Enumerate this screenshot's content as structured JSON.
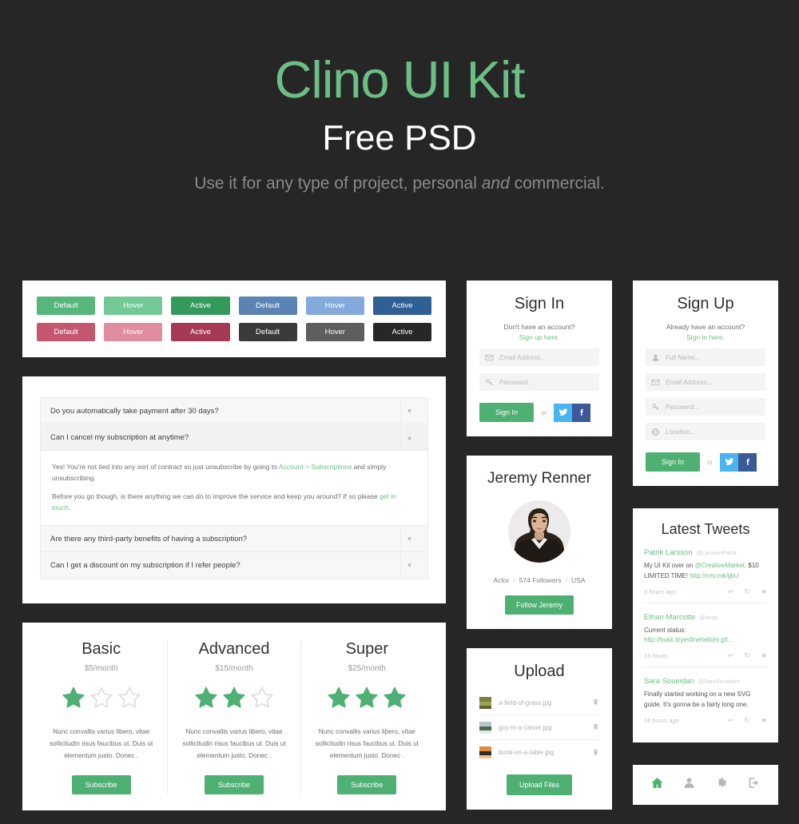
{
  "hero": {
    "title": "Clino UI Kit",
    "subtitle": "Free PSD",
    "description_pre": "Use it for any type of project, personal ",
    "description_em": "and",
    "description_post": " commercial."
  },
  "colors": {
    "background": "#262626",
    "green": "#4fb073",
    "green_light": "#6cbf84",
    "green_hover": "#72c995",
    "green_active": "#349a5c",
    "blue": "#5b83b5",
    "blue_hover": "#84aadb",
    "blue_active": "#2f5f95",
    "pink": "#c5566f",
    "pink_hover": "#e08ba0",
    "pink_active": "#a63a55",
    "dark": "#3b3b3b",
    "dark_hover": "#5e5e5e",
    "dark_active": "#272727",
    "twitter": "#4ab3f4",
    "facebook": "#3b5998"
  },
  "buttons": {
    "rows": [
      [
        {
          "label": "Default",
          "color": "#57b67c"
        },
        {
          "label": "Hover",
          "color": "#72c995"
        },
        {
          "label": "Active",
          "color": "#349a5c"
        },
        {
          "label": "Default",
          "color": "#5b83b5"
        },
        {
          "label": "Hover",
          "color": "#84aadb"
        },
        {
          "label": "Active",
          "color": "#2f5f95"
        }
      ],
      [
        {
          "label": "Default",
          "color": "#c5566f"
        },
        {
          "label": "Hover",
          "color": "#e08ba0"
        },
        {
          "label": "Active",
          "color": "#a63a55"
        },
        {
          "label": "Default",
          "color": "#3b3b3b"
        },
        {
          "label": "Hover",
          "color": "#5e5e5e"
        },
        {
          "label": "Active",
          "color": "#272727"
        }
      ]
    ]
  },
  "faq": {
    "items": [
      {
        "question": "Do you automatically take payment after 30 days?",
        "open": false
      },
      {
        "question": "Can I cancel my subscription at anytime?",
        "open": true
      },
      {
        "question": "Are there any third-party benefits of having a subscription?",
        "open": false
      },
      {
        "question": "Can I get a discount on my subscription if I refer people?",
        "open": false
      }
    ],
    "answer": {
      "p1_pre": "Yes! You're not tied into any sort of contract so just unsubscribe by going to ",
      "p1_link": "Account > Subscriptions",
      "p1_post": " and simply unsubscribing.",
      "p2_pre": "Before you go though, is there anything we can do to improve the service and keep you around? If so please ",
      "p2_link": "get in touch",
      "p2_post": "."
    },
    "arrow_down": "▼",
    "arrow_up": "▲"
  },
  "pricing": {
    "plans": [
      {
        "name": "Basic",
        "price": "$5/month",
        "stars_filled": 1,
        "stars_total": 3,
        "description": "Nunc convallis varius libero, vitae sollicitudin risus faucibus ut. Duis ut elementum justo. Donec .",
        "cta": "Subscribe"
      },
      {
        "name": "Advanced",
        "price": "$15/month",
        "stars_filled": 2,
        "stars_total": 3,
        "description": "Nunc convallis varius libero, vitae sollicitudin risus faucibus ut. Duis ut elementum justo. Donec .",
        "cta": "Subscribe"
      },
      {
        "name": "Super",
        "price": "$25/month",
        "stars_filled": 3,
        "stars_total": 3,
        "description": "Nunc convallis varius libero, vitae sollicitudin risus faucibus ut. Duis ut elementum justo. Donec .",
        "cta": "Subscribe"
      }
    ]
  },
  "signin": {
    "title": "Sign In",
    "prompt": "Don't have an account?",
    "prompt_link": "Sign up here.",
    "fields": [
      {
        "icon": "envelope-icon",
        "placeholder": "Email Address...",
        "value": ""
      },
      {
        "icon": "key-icon",
        "placeholder": "Password...",
        "value": ""
      }
    ],
    "submit": "Sign In",
    "or": "or",
    "social": [
      {
        "name": "twitter-button",
        "glyph": "🐦",
        "color": "#4ab3f4"
      },
      {
        "name": "facebook-button",
        "glyph": "f",
        "color": "#3b5998"
      }
    ]
  },
  "signup": {
    "title": "Sign Up",
    "prompt": "Already have an account?",
    "prompt_link": "Sign in here.",
    "fields": [
      {
        "icon": "user-icon",
        "placeholder": "Full Name...",
        "value": ""
      },
      {
        "icon": "envelope-icon",
        "placeholder": "Email Address...",
        "value": ""
      },
      {
        "icon": "key-icon",
        "placeholder": "Password...",
        "value": ""
      },
      {
        "icon": "globe-icon",
        "placeholder": "Location...",
        "value": ""
      }
    ],
    "submit": "Sign In",
    "or": "or"
  },
  "profile": {
    "name": "Jeremy Renner",
    "role": "Actor",
    "followers": "574 Followers",
    "country": "USA",
    "cta": "Follow Jeremy"
  },
  "upload": {
    "title": "Upload",
    "files": [
      {
        "name": "a-field-of-grass.jpg",
        "colors": [
          "#7a7f3c",
          "#9aa34e",
          "#5e6330"
        ]
      },
      {
        "name": "guy-in-a-canoe.jpg",
        "colors": [
          "#b8c6cc",
          "#4b6b55",
          "#e4e9ea"
        ]
      },
      {
        "name": "book-on-a-table.jpg",
        "colors": [
          "#e08a3c",
          "#2b2b2b",
          "#f0c08a"
        ]
      }
    ],
    "delete_icon": "trash-icon",
    "cta": "Upload Files"
  },
  "tweets": {
    "title": "Latest Tweets",
    "items": [
      {
        "user": "Patrik Larsson",
        "handle": "@LarssonPatrik",
        "body_pre": "My UI Kit over on ",
        "body_link1": "@CreativeMarket.",
        "body_mid": " $10 LIMITED TIME! ",
        "body_link2": "http://crtv.mk/ijbU",
        "time": "6 hours ago"
      },
      {
        "user": "Ethan Marcotte",
        "handle": "@beep",
        "body_pre": "Current status: ",
        "body_link1": "http://bukk.it/yesfinehellohi.gif...",
        "body_mid": "",
        "body_link2": "",
        "time": "15 hours"
      },
      {
        "user": "Sara Soueidan",
        "handle": "@SaraSoueidan",
        "body_pre": "Finally started working on a new SVG guide. It's gonna be a fairly long one.",
        "body_link1": "",
        "body_mid": "",
        "body_link2": "",
        "time": "18 hours ago"
      }
    ],
    "actions": [
      {
        "name": "reply-icon",
        "glyph": "↩"
      },
      {
        "name": "retweet-icon",
        "glyph": "↻"
      },
      {
        "name": "favorite-icon",
        "glyph": "★"
      }
    ]
  },
  "iconbar": {
    "items": [
      {
        "name": "home-icon",
        "active": true
      },
      {
        "name": "user-icon",
        "active": false
      },
      {
        "name": "gear-icon",
        "active": false
      },
      {
        "name": "logout-icon",
        "active": false
      }
    ]
  }
}
